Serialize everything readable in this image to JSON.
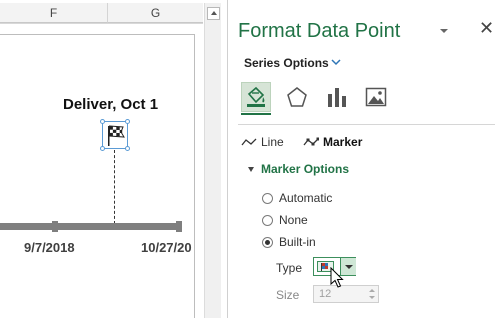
{
  "sheet": {
    "columns": [
      {
        "label": "F"
      },
      {
        "label": "G"
      }
    ],
    "chart": {
      "milestone_label": "Deliver, Oct 1",
      "marker_icon": "checkered-flag-icon",
      "axis_dates": [
        "9/7/2018",
        "10/27/20"
      ]
    }
  },
  "pane": {
    "title": "Format Data Point",
    "options_icon": "dropdown-arrow-icon",
    "close_icon": "close-icon",
    "close_glyph": "✕",
    "series_options_label": "Series Options",
    "categories": [
      {
        "name": "fill-line",
        "icon": "paint-bucket-icon",
        "selected": true
      },
      {
        "name": "effects",
        "icon": "pentagon-icon",
        "selected": false
      },
      {
        "name": "series-options",
        "icon": "bar-chart-icon",
        "selected": false
      },
      {
        "name": "size-properties",
        "icon": "picture-icon",
        "selected": false
      }
    ],
    "subtabs": {
      "line_label": "Line",
      "marker_label": "Marker",
      "selected": "Marker"
    },
    "marker_options": {
      "heading": "Marker Options",
      "radios": [
        {
          "label": "Automatic",
          "checked": false
        },
        {
          "label": "None",
          "checked": false
        },
        {
          "label": "Built-in",
          "checked": true
        }
      ],
      "type_label": "Type",
      "size_label": "Size",
      "size_value": "12"
    }
  },
  "colors": {
    "accent": "#217346",
    "selection": "#5b9bd5",
    "timeline": "#7f7f7f"
  }
}
